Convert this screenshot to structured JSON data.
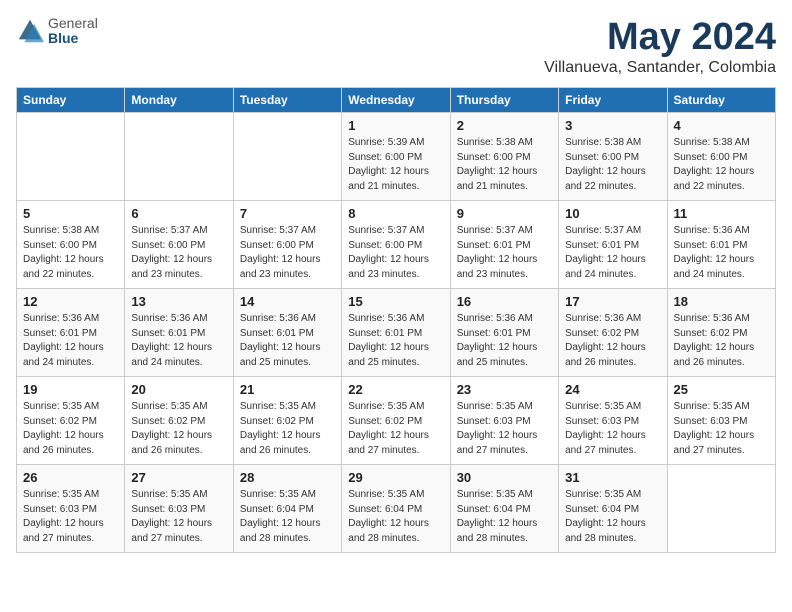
{
  "header": {
    "logo": {
      "general": "General",
      "blue": "Blue"
    },
    "title": "May 2024",
    "location": "Villanueva, Santander, Colombia"
  },
  "weekdays": [
    "Sunday",
    "Monday",
    "Tuesday",
    "Wednesday",
    "Thursday",
    "Friday",
    "Saturday"
  ],
  "weeks": [
    [
      {
        "day": "",
        "info": ""
      },
      {
        "day": "",
        "info": ""
      },
      {
        "day": "",
        "info": ""
      },
      {
        "day": "1",
        "info": "Sunrise: 5:39 AM\nSunset: 6:00 PM\nDaylight: 12 hours\nand 21 minutes."
      },
      {
        "day": "2",
        "info": "Sunrise: 5:38 AM\nSunset: 6:00 PM\nDaylight: 12 hours\nand 21 minutes."
      },
      {
        "day": "3",
        "info": "Sunrise: 5:38 AM\nSunset: 6:00 PM\nDaylight: 12 hours\nand 22 minutes."
      },
      {
        "day": "4",
        "info": "Sunrise: 5:38 AM\nSunset: 6:00 PM\nDaylight: 12 hours\nand 22 minutes."
      }
    ],
    [
      {
        "day": "5",
        "info": "Sunrise: 5:38 AM\nSunset: 6:00 PM\nDaylight: 12 hours\nand 22 minutes."
      },
      {
        "day": "6",
        "info": "Sunrise: 5:37 AM\nSunset: 6:00 PM\nDaylight: 12 hours\nand 23 minutes."
      },
      {
        "day": "7",
        "info": "Sunrise: 5:37 AM\nSunset: 6:00 PM\nDaylight: 12 hours\nand 23 minutes."
      },
      {
        "day": "8",
        "info": "Sunrise: 5:37 AM\nSunset: 6:00 PM\nDaylight: 12 hours\nand 23 minutes."
      },
      {
        "day": "9",
        "info": "Sunrise: 5:37 AM\nSunset: 6:01 PM\nDaylight: 12 hours\nand 23 minutes."
      },
      {
        "day": "10",
        "info": "Sunrise: 5:37 AM\nSunset: 6:01 PM\nDaylight: 12 hours\nand 24 minutes."
      },
      {
        "day": "11",
        "info": "Sunrise: 5:36 AM\nSunset: 6:01 PM\nDaylight: 12 hours\nand 24 minutes."
      }
    ],
    [
      {
        "day": "12",
        "info": "Sunrise: 5:36 AM\nSunset: 6:01 PM\nDaylight: 12 hours\nand 24 minutes."
      },
      {
        "day": "13",
        "info": "Sunrise: 5:36 AM\nSunset: 6:01 PM\nDaylight: 12 hours\nand 24 minutes."
      },
      {
        "day": "14",
        "info": "Sunrise: 5:36 AM\nSunset: 6:01 PM\nDaylight: 12 hours\nand 25 minutes."
      },
      {
        "day": "15",
        "info": "Sunrise: 5:36 AM\nSunset: 6:01 PM\nDaylight: 12 hours\nand 25 minutes."
      },
      {
        "day": "16",
        "info": "Sunrise: 5:36 AM\nSunset: 6:01 PM\nDaylight: 12 hours\nand 25 minutes."
      },
      {
        "day": "17",
        "info": "Sunrise: 5:36 AM\nSunset: 6:02 PM\nDaylight: 12 hours\nand 26 minutes."
      },
      {
        "day": "18",
        "info": "Sunrise: 5:36 AM\nSunset: 6:02 PM\nDaylight: 12 hours\nand 26 minutes."
      }
    ],
    [
      {
        "day": "19",
        "info": "Sunrise: 5:35 AM\nSunset: 6:02 PM\nDaylight: 12 hours\nand 26 minutes."
      },
      {
        "day": "20",
        "info": "Sunrise: 5:35 AM\nSunset: 6:02 PM\nDaylight: 12 hours\nand 26 minutes."
      },
      {
        "day": "21",
        "info": "Sunrise: 5:35 AM\nSunset: 6:02 PM\nDaylight: 12 hours\nand 26 minutes."
      },
      {
        "day": "22",
        "info": "Sunrise: 5:35 AM\nSunset: 6:02 PM\nDaylight: 12 hours\nand 27 minutes."
      },
      {
        "day": "23",
        "info": "Sunrise: 5:35 AM\nSunset: 6:03 PM\nDaylight: 12 hours\nand 27 minutes."
      },
      {
        "day": "24",
        "info": "Sunrise: 5:35 AM\nSunset: 6:03 PM\nDaylight: 12 hours\nand 27 minutes."
      },
      {
        "day": "25",
        "info": "Sunrise: 5:35 AM\nSunset: 6:03 PM\nDaylight: 12 hours\nand 27 minutes."
      }
    ],
    [
      {
        "day": "26",
        "info": "Sunrise: 5:35 AM\nSunset: 6:03 PM\nDaylight: 12 hours\nand 27 minutes."
      },
      {
        "day": "27",
        "info": "Sunrise: 5:35 AM\nSunset: 6:03 PM\nDaylight: 12 hours\nand 27 minutes."
      },
      {
        "day": "28",
        "info": "Sunrise: 5:35 AM\nSunset: 6:04 PM\nDaylight: 12 hours\nand 28 minutes."
      },
      {
        "day": "29",
        "info": "Sunrise: 5:35 AM\nSunset: 6:04 PM\nDaylight: 12 hours\nand 28 minutes."
      },
      {
        "day": "30",
        "info": "Sunrise: 5:35 AM\nSunset: 6:04 PM\nDaylight: 12 hours\nand 28 minutes."
      },
      {
        "day": "31",
        "info": "Sunrise: 5:35 AM\nSunset: 6:04 PM\nDaylight: 12 hours\nand 28 minutes."
      },
      {
        "day": "",
        "info": ""
      }
    ]
  ]
}
